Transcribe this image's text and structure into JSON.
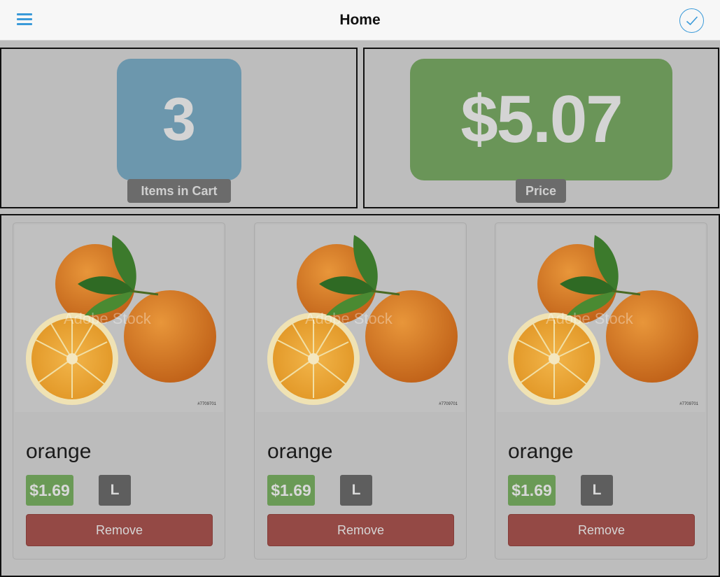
{
  "header": {
    "title": "Home",
    "menu_icon": "hamburger-menu-icon",
    "confirm_icon": "checkmark-circle-icon",
    "accent_color": "#3a9ad9"
  },
  "stats": {
    "items_count": "3",
    "items_label": "Items in Cart",
    "price_value": "$5.07",
    "price_label": "Price"
  },
  "products": [
    {
      "name": "orange",
      "price": "$1.69",
      "size": "L",
      "remove_label": "Remove",
      "watermark": "Adobe Stock",
      "stock_id": "#7709701"
    },
    {
      "name": "orange",
      "price": "$1.69",
      "size": "L",
      "remove_label": "Remove",
      "watermark": "Adobe Stock",
      "stock_id": "#7709701"
    },
    {
      "name": "orange",
      "price": "$1.69",
      "size": "L",
      "remove_label": "Remove",
      "watermark": "Adobe Stock",
      "stock_id": "#7709701"
    }
  ]
}
